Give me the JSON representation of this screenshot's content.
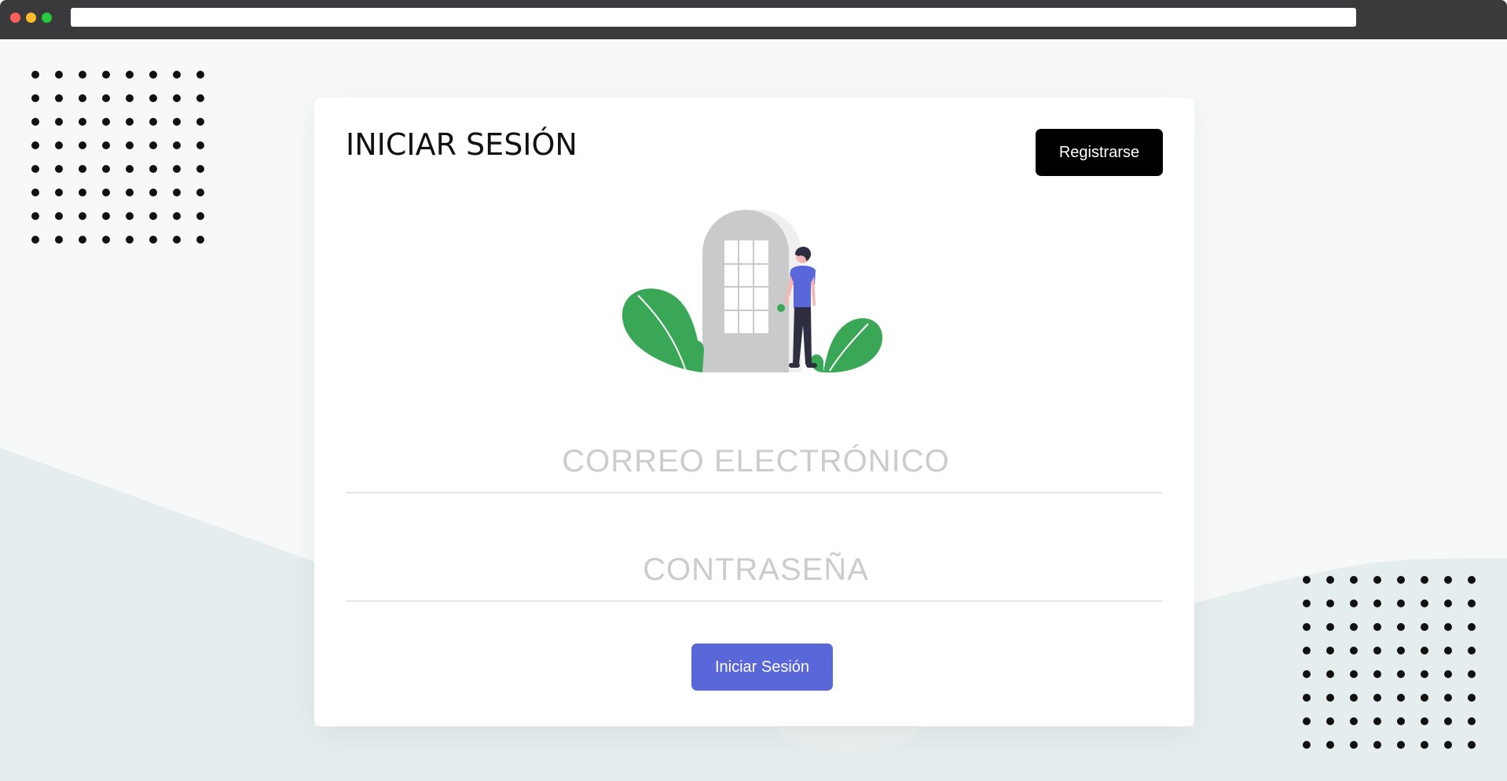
{
  "window": {
    "controls": [
      "close",
      "minimize",
      "maximize"
    ],
    "address_bar_value": ""
  },
  "login": {
    "title": "INICIAR SESIÓN",
    "register_label": "Registrarse",
    "email_placeholder": "CORREO ELECTRÓNICO",
    "password_placeholder": "CONTRASEÑA",
    "submit_label": "Iniciar Sesión"
  },
  "illustration": {
    "icon": "person-at-door-illustration"
  },
  "colors": {
    "background": "#f7f8f8",
    "wave": "#e6edee",
    "primary_button": "#5a67d8",
    "register_button": "#000000",
    "plant_green": "#3aa757",
    "person_shirt": "#5a67d8"
  }
}
